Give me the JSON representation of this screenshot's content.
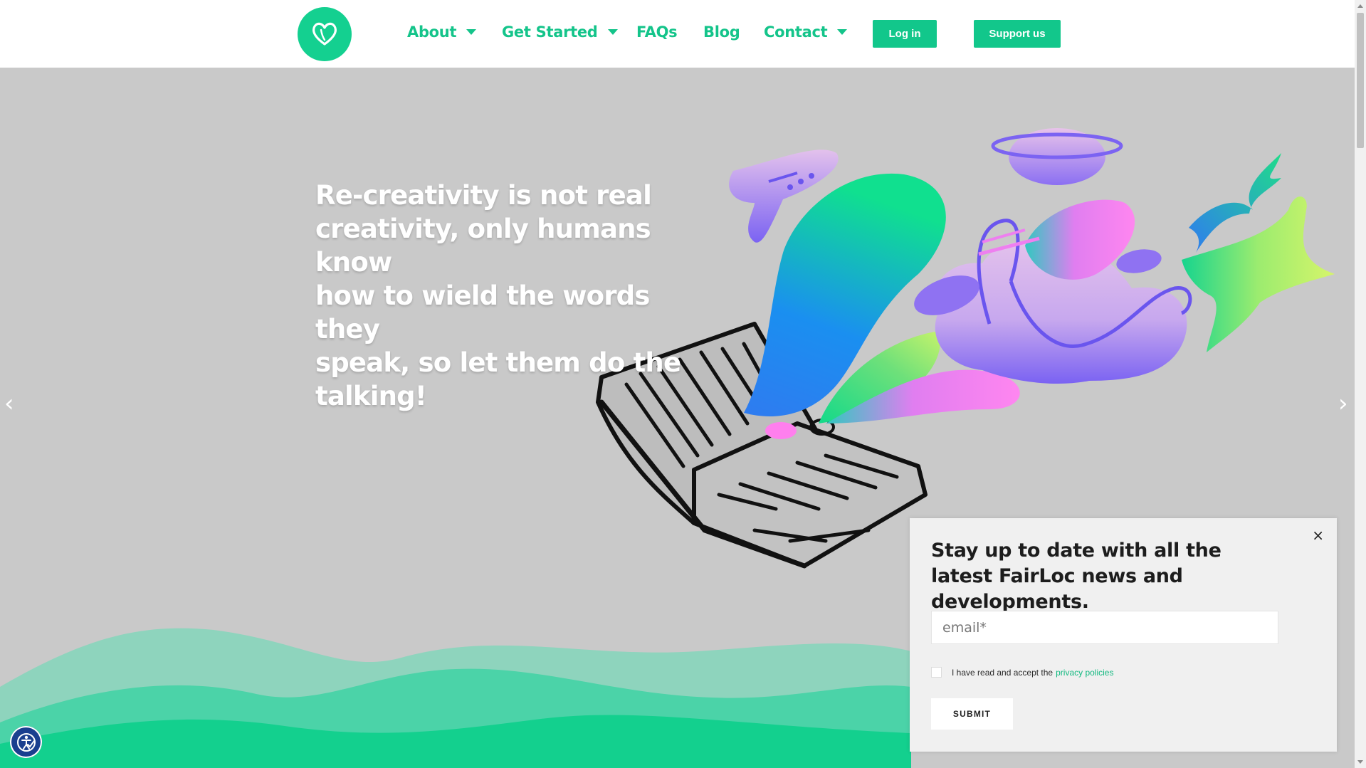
{
  "header": {
    "logo_icon": "heart-icon",
    "nav": [
      {
        "label": "About",
        "has_dropdown": true
      },
      {
        "label": "Get Started",
        "has_dropdown": true
      },
      {
        "label": "FAQs",
        "has_dropdown": false
      },
      {
        "label": "Blog",
        "has_dropdown": false
      },
      {
        "label": "Contact",
        "has_dropdown": true
      }
    ],
    "login_label": "Log in",
    "support_label": "Support us"
  },
  "hero": {
    "lines": [
      "Re-creativity is not real",
      "creativity, only humans know",
      "how to wield the words they",
      "speak, so let them do the",
      "talking!"
    ],
    "prev_icon": "chevron-left-icon",
    "next_icon": "chevron-right-icon",
    "illustration_icon": "book-creativity-illustration"
  },
  "popup": {
    "close_label": "×",
    "title": "Stay up to date with all the latest FairLoc news and developments.",
    "email_placeholder": "email*",
    "consent_text": "I have read and accept the",
    "privacy_link": "privacy policies",
    "submit_label": "SUBMIT"
  },
  "accessibility_icon": "accessibility-icon",
  "colors": {
    "brand_green": "#14c48a",
    "button_green": "#12c78b",
    "hero_bg": "#c9c9c9",
    "a11y_blue": "#1a3f8f"
  }
}
